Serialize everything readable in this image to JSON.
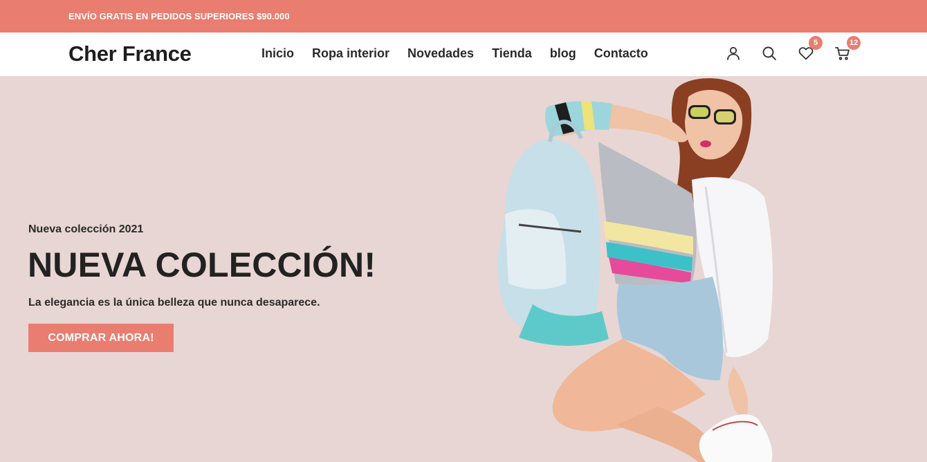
{
  "topbar": {
    "text": "ENVÍO GRATIS EN PEDIDOS SUPERIORES $90.000"
  },
  "header": {
    "logo": "Cher France",
    "nav": [
      "Inicio",
      "Ropa interior",
      "Novedades",
      "Tienda",
      "blog",
      "Contacto"
    ],
    "icons": {
      "account": "user-icon",
      "search": "search-icon",
      "wishlist": "heart-icon",
      "cart": "cart-icon"
    },
    "wishlist_count": "5",
    "cart_count": "12"
  },
  "hero": {
    "eyebrow": "Nueva colección 2021",
    "title": "NUEVA COLECCIÓN!",
    "subtitle": "La elegancia es la única belleza que nunca desaparece.",
    "cta": "COMPRAR AHORA!"
  },
  "colors": {
    "accent": "#e97d70",
    "hero_bg": "#e8d6d4",
    "text": "#222222"
  }
}
